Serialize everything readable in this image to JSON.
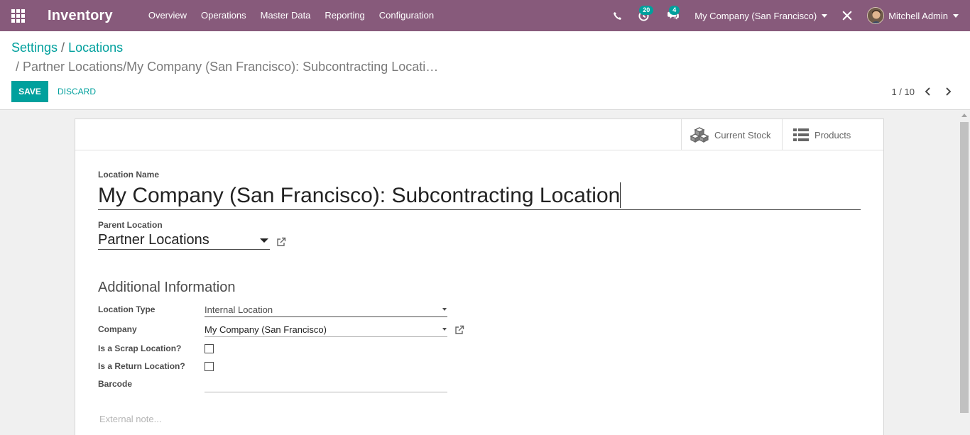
{
  "navbar": {
    "brand": "Inventory",
    "menu": [
      "Overview",
      "Operations",
      "Master Data",
      "Reporting",
      "Configuration"
    ],
    "activity_count": "20",
    "message_count": "4",
    "company": "My Company (San Francisco)",
    "user": "Mitchell Admin",
    "colors": {
      "bar": "#875a7b",
      "badge": "#00a09d"
    },
    "icons": [
      "apps-grid-icon",
      "phone-icon",
      "clock-icon",
      "chat-icon",
      "tools-icon"
    ]
  },
  "breadcrumb": {
    "items": [
      "Settings",
      "Locations"
    ],
    "current": "Partner Locations/My Company (San Francisco): Subcontracting Locati…"
  },
  "actions": {
    "save": "SAVE",
    "discard": "DISCARD"
  },
  "pager": {
    "value": "1 / 10"
  },
  "smart_buttons": [
    {
      "label": "Current Stock",
      "icon": "cubes-icon"
    },
    {
      "label": "Products",
      "icon": "list-icon"
    }
  ],
  "form": {
    "location_name_label": "Location Name",
    "location_name": "My Company (San Francisco): Subcontracting Location",
    "parent_location_label": "Parent Location",
    "parent_location": "Partner Locations",
    "section_title": "Additional Information",
    "location_type_label": "Location Type",
    "location_type": "Internal Location",
    "company_label": "Company",
    "company": "My Company (San Francisco)",
    "scrap_label": "Is a Scrap Location?",
    "scrap_checked": false,
    "return_label": "Is a Return Location?",
    "return_checked": false,
    "barcode_label": "Barcode",
    "barcode": "",
    "note_placeholder": "External note..."
  },
  "accent_color": "#00a09d"
}
